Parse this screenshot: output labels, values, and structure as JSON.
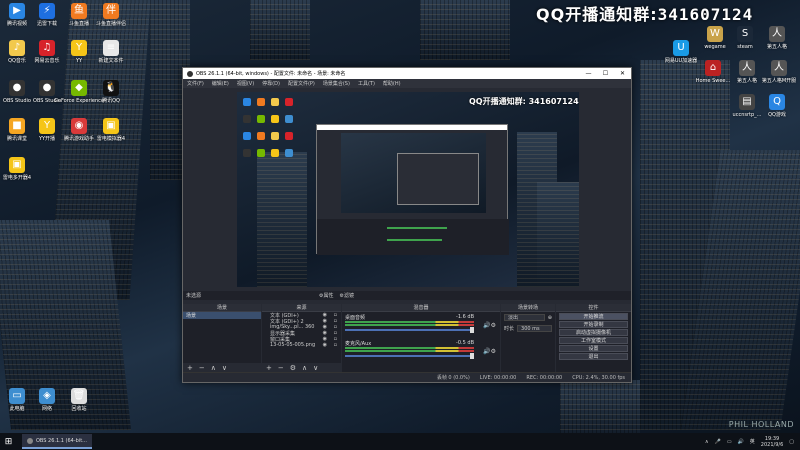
{
  "desktop": {
    "banner_prefix": "QQ开播通知群:",
    "banner_number": "341607124",
    "watermark": "PHIL HOLLAND",
    "left_icons": [
      {
        "label": "腾讯视频",
        "color": "#2a86e3",
        "glyph": "▶"
      },
      {
        "label": "迅雷下载",
        "color": "#1e6fe0",
        "glyph": "⚡"
      },
      {
        "label": "斗鱼直播",
        "color": "#f07a20",
        "glyph": "鱼"
      },
      {
        "label": "斗鱼直播伴侣",
        "color": "#f07a20",
        "glyph": "伴"
      },
      {
        "label": "QQ音乐",
        "color": "#f2c94c",
        "glyph": "♪"
      },
      {
        "label": "网易云音乐",
        "color": "#d7232a",
        "glyph": "♫"
      },
      {
        "label": "YY",
        "color": "#f5c518",
        "glyph": "Y"
      },
      {
        "label": "新建文本件",
        "color": "#e8e8e8",
        "glyph": "≡"
      },
      {
        "label": "OBS Studio",
        "color": "#333",
        "glyph": "●"
      },
      {
        "label": "OBS Studio",
        "color": "#333",
        "glyph": "●"
      },
      {
        "label": "GeForce Experience",
        "color": "#76b900",
        "glyph": "◆"
      },
      {
        "label": "腾讯QQ",
        "color": "#111",
        "glyph": "🐧"
      },
      {
        "label": "腾讯课堂",
        "color": "#f5a623",
        "glyph": "■"
      },
      {
        "label": "YY开播",
        "color": "#f5c518",
        "glyph": "Y"
      },
      {
        "label": "腾讯游戏助手",
        "color": "#d93a3a",
        "glyph": "◉"
      },
      {
        "label": "雷电模拟器4",
        "color": "#f5c518",
        "glyph": "▣"
      },
      {
        "label": "雷电多开器4",
        "color": "#f5c518",
        "glyph": "▣"
      }
    ],
    "bottom_icons": [
      {
        "label": "此电脑",
        "color": "#3e8ed0",
        "glyph": "▭"
      },
      {
        "label": "网络",
        "color": "#3e8ed0",
        "glyph": "◈"
      },
      {
        "label": "回收站",
        "color": "#ddd",
        "glyph": "🗑"
      }
    ],
    "right_icons": [
      {
        "label": "网易UU加速器",
        "color": "#1a9be6",
        "glyph": "U"
      },
      {
        "label": "wegame",
        "color": "#c9a34a",
        "glyph": "W"
      },
      {
        "label": "steam",
        "color": "#1b2838",
        "glyph": "S"
      },
      {
        "label": "第五人格",
        "color": "#555",
        "glyph": "人"
      },
      {
        "label": "Home Swee...",
        "color": "#b22",
        "glyph": "⌂"
      },
      {
        "label": "第五人格",
        "color": "#555",
        "glyph": "人"
      },
      {
        "label": "第五人格M开服",
        "color": "#555",
        "glyph": "人"
      },
      {
        "label": "uccnsrtp_...",
        "color": "#444",
        "glyph": "▤"
      },
      {
        "label": "QQ游戏",
        "color": "#2a86e3",
        "glyph": "Q"
      }
    ]
  },
  "taskbar": {
    "start_icon": "windows-icon",
    "obs_task_label": "OBS 26.1.1 (64-bit...",
    "time": "19:39",
    "date": "2021/9/6",
    "ime": "英"
  },
  "obs": {
    "title": "OBS 26.1.1 (64-bit, windows) - 配置文件: 未命名 - 场景: 未命名",
    "menu": [
      "文件(F)",
      "编辑(E)",
      "视图(V)",
      "停靠(D)",
      "配置文件(P)",
      "场景集合(S)",
      "工具(T)",
      "帮助(H)"
    ],
    "preview_banner": "QQ开播通知群: 341607124",
    "dock_header_label": "未选源",
    "dock_header_actions": [
      "属性",
      "滤镜"
    ],
    "scenes": {
      "title": "场景",
      "items": [
        "场景"
      ]
    },
    "sources": {
      "title": "来源",
      "items": [
        "文本 (GDI+)",
        "文本 (GDI+) 2",
        "img/Sky...pl... 360",
        "显示器采集",
        "窗口采集",
        "13-05-05-005.png"
      ]
    },
    "mixer": {
      "title": "混音器",
      "channels": [
        {
          "name": "桌面音频",
          "db": "-1.6 dB"
        },
        {
          "name": "麦克风/Aux",
          "db": "-0.5 dB"
        }
      ]
    },
    "transitions": {
      "title": "场景转场",
      "type": "淡出",
      "duration_label": "时长",
      "duration": "300 ms"
    },
    "controls": {
      "title": "控件",
      "buttons": [
        "开始推流",
        "开始录制",
        "启动虚拟摄像机",
        "工作室模式",
        "设置",
        "退出"
      ]
    },
    "status": [
      "丢帧 0 (0.0%)",
      "LIVE: 00:00:00",
      "REC: 00:00:00",
      "CPU: 2.4%, 30.00 fps"
    ]
  }
}
